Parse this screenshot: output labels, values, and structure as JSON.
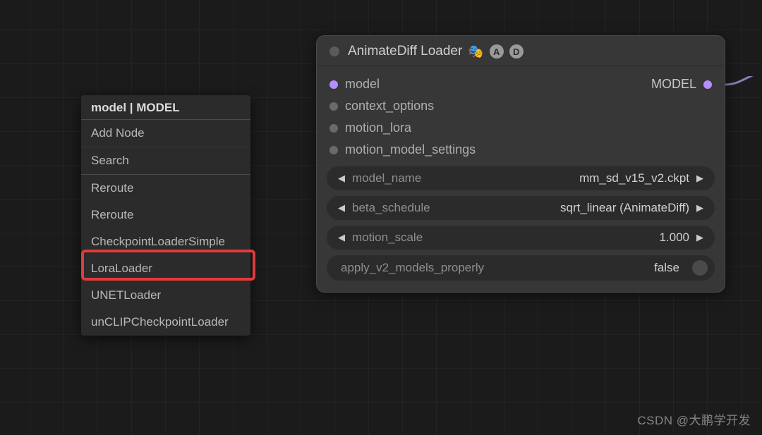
{
  "context_menu": {
    "title": "model | MODEL",
    "add_node": "Add Node",
    "search": "Search",
    "items": [
      "Reroute",
      "Reroute",
      "CheckpointLoaderSimple",
      "LoraLoader",
      "UNETLoader",
      "unCLIPCheckpointLoader"
    ]
  },
  "node": {
    "title": "AnimateDiff Loader",
    "emoji": "🎭",
    "badge_a": "A",
    "badge_d": "D",
    "inputs": {
      "model": "model",
      "context_options": "context_options",
      "motion_lora": "motion_lora",
      "motion_model_settings": "motion_model_settings"
    },
    "outputs": {
      "model": "MODEL"
    },
    "widgets": {
      "model_name": {
        "label": "model_name",
        "value": "mm_sd_v15_v2.ckpt"
      },
      "beta_schedule": {
        "label": "beta_schedule",
        "value": "sqrt_linear (AnimateDiff)"
      },
      "motion_scale": {
        "label": "motion_scale",
        "value": "1.000"
      },
      "apply_v2": {
        "label": "apply_v2_models_properly",
        "value": "false"
      }
    }
  },
  "watermark": "CSDN @大鹏学开发"
}
